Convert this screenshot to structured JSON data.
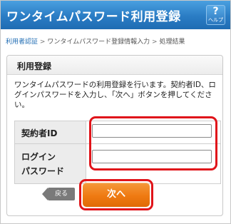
{
  "header": {
    "title": "ワンタイムパスワード利用登録",
    "help_symbol": "?",
    "help_label": "ヘルプ"
  },
  "breadcrumb": {
    "items": [
      "利用者認証",
      "ワンタイムパスワード登録情報入力",
      "処理結果"
    ],
    "separator": ">"
  },
  "panel": {
    "heading": "利用登録",
    "description": "ワンタイムパスワードの利用登録を行います。契約者ID、ログインパスワードを入力し、「次へ」ボタンを押してください。"
  },
  "form": {
    "contract_id_label": "契約者ID",
    "password_label_line1": "ログイン",
    "password_label_line2": "パスワード",
    "contract_id_value": "",
    "password_value": ""
  },
  "buttons": {
    "back_label": "戻る",
    "next_label": "次へ"
  },
  "colors": {
    "header_blue": "#2a7cc4",
    "link_blue": "#1f6cb3",
    "highlight_red": "#e0141a",
    "next_orange": "#ef7a12",
    "back_gray": "#7a7a7a"
  }
}
